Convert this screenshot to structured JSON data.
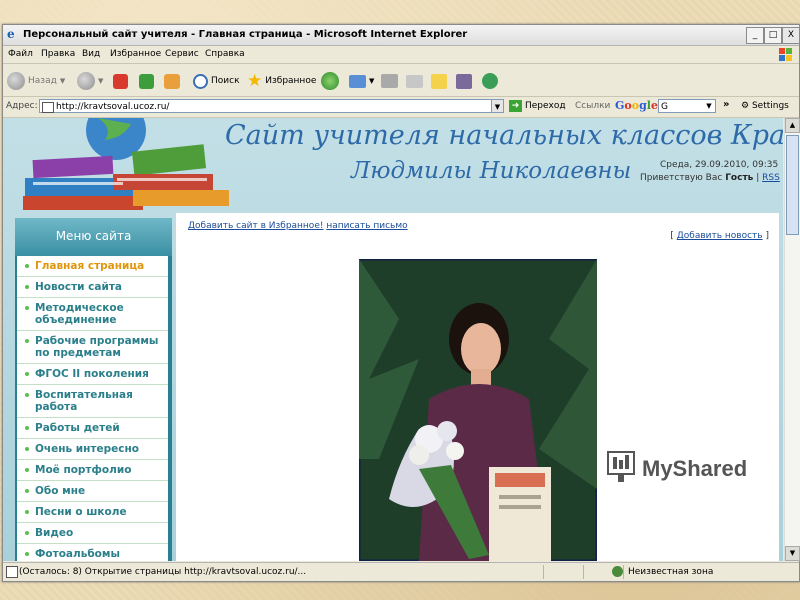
{
  "window": {
    "title": "Персональный сайт учителя - Главная страница - Microsoft Internet Explorer",
    "btn_minimize": "_",
    "btn_maximize": "□",
    "btn_close": "X"
  },
  "menubar": [
    "Файл",
    "Правка",
    "Вид",
    "Избранное",
    "Сервис",
    "Справка"
  ],
  "toolbar": {
    "back": "Назад",
    "search": "Поиск",
    "favorites": "Избранное"
  },
  "address": {
    "label": "Адрес:",
    "url": "http://kravtsoval.ucoz.ru/",
    "go": "Переход",
    "links": "Ссылки",
    "google": "Google",
    "google_input": "G",
    "settings": "Settings"
  },
  "site": {
    "title_line1": "Сайт учителя начальных классов Кравцовой",
    "title_line2": "Людмилы Николаевны",
    "date_line": "Среда, 29.09.2010, 09:35",
    "greeting_prefix": "Приветствую Вас",
    "greeting_user": "Гость",
    "greeting_sep": "|",
    "rss": "RSS",
    "menu_header": "Меню сайта",
    "menu_items": [
      "Главная страница",
      "Новости сайта",
      "Методическое объединение",
      "Рабочие программы по предметам",
      "ФГОС II поколения",
      "Воспитательная работа",
      "Работы детей",
      "Очень интересно",
      "Моё портфолио",
      "Обо мне",
      "Песни о школе",
      "Видео",
      "Фотоальбомы"
    ],
    "add_favorites": "Добавить сайт в Избранное!",
    "write_letter": "написать письмо",
    "add_news_open": "[",
    "add_news": "Добавить новость",
    "add_news_close": "]"
  },
  "status": {
    "text": "(Осталось: 8) Открытие страницы http://kravtsoval.ucoz.ru/...",
    "zone": "Неизвестная зона"
  },
  "overlay": {
    "brand": "MyShared"
  },
  "colors": {
    "title_blue": "#2d6aa8",
    "menu_teal": "#2a7f8a",
    "menu_active": "#e0960c",
    "sidebar_bg": "#2b7f92"
  }
}
